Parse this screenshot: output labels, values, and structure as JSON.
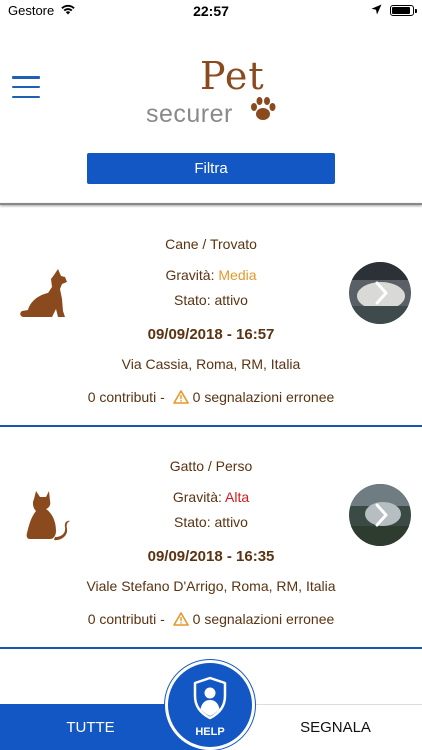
{
  "status_bar": {
    "carrier": "Gestore",
    "time": "22:57",
    "battery_level": 0.9
  },
  "header": {
    "logo_top": "Pet",
    "logo_bottom": "securer",
    "filter_label": "Filtra"
  },
  "reports": [
    {
      "type": "Cane / Trovato",
      "animal_icon": "dog-icon",
      "severity_label": "Gravità: ",
      "severity_value": "Media",
      "status": "Stato: attivo",
      "datetime": "09/09/2018 - 16:57",
      "address": "Via Cassia, Roma, RM, Italia",
      "contributions": "0 contributi - ",
      "errors": "0 segnalazioni erronee"
    },
    {
      "type": "Gatto / Perso",
      "animal_icon": "cat-icon",
      "severity_label": "Gravità: ",
      "severity_value": "Alta",
      "status": "Stato: attivo",
      "datetime": "09/09/2018 - 16:35",
      "address": "Viale Stefano D'Arrigo, Roma, RM, Italia",
      "contributions": "0 contributi - ",
      "errors": "0 segnalazioni erronee"
    }
  ],
  "bottom_bar": {
    "tab_all": "TUTTE",
    "tab_report": "SEGNALA",
    "help": "HELP"
  },
  "colors": {
    "accent_blue": "#1357c4",
    "brown": "#8a4a1e",
    "severity_media": "#e8962a",
    "severity_alta": "#d71a1a"
  }
}
